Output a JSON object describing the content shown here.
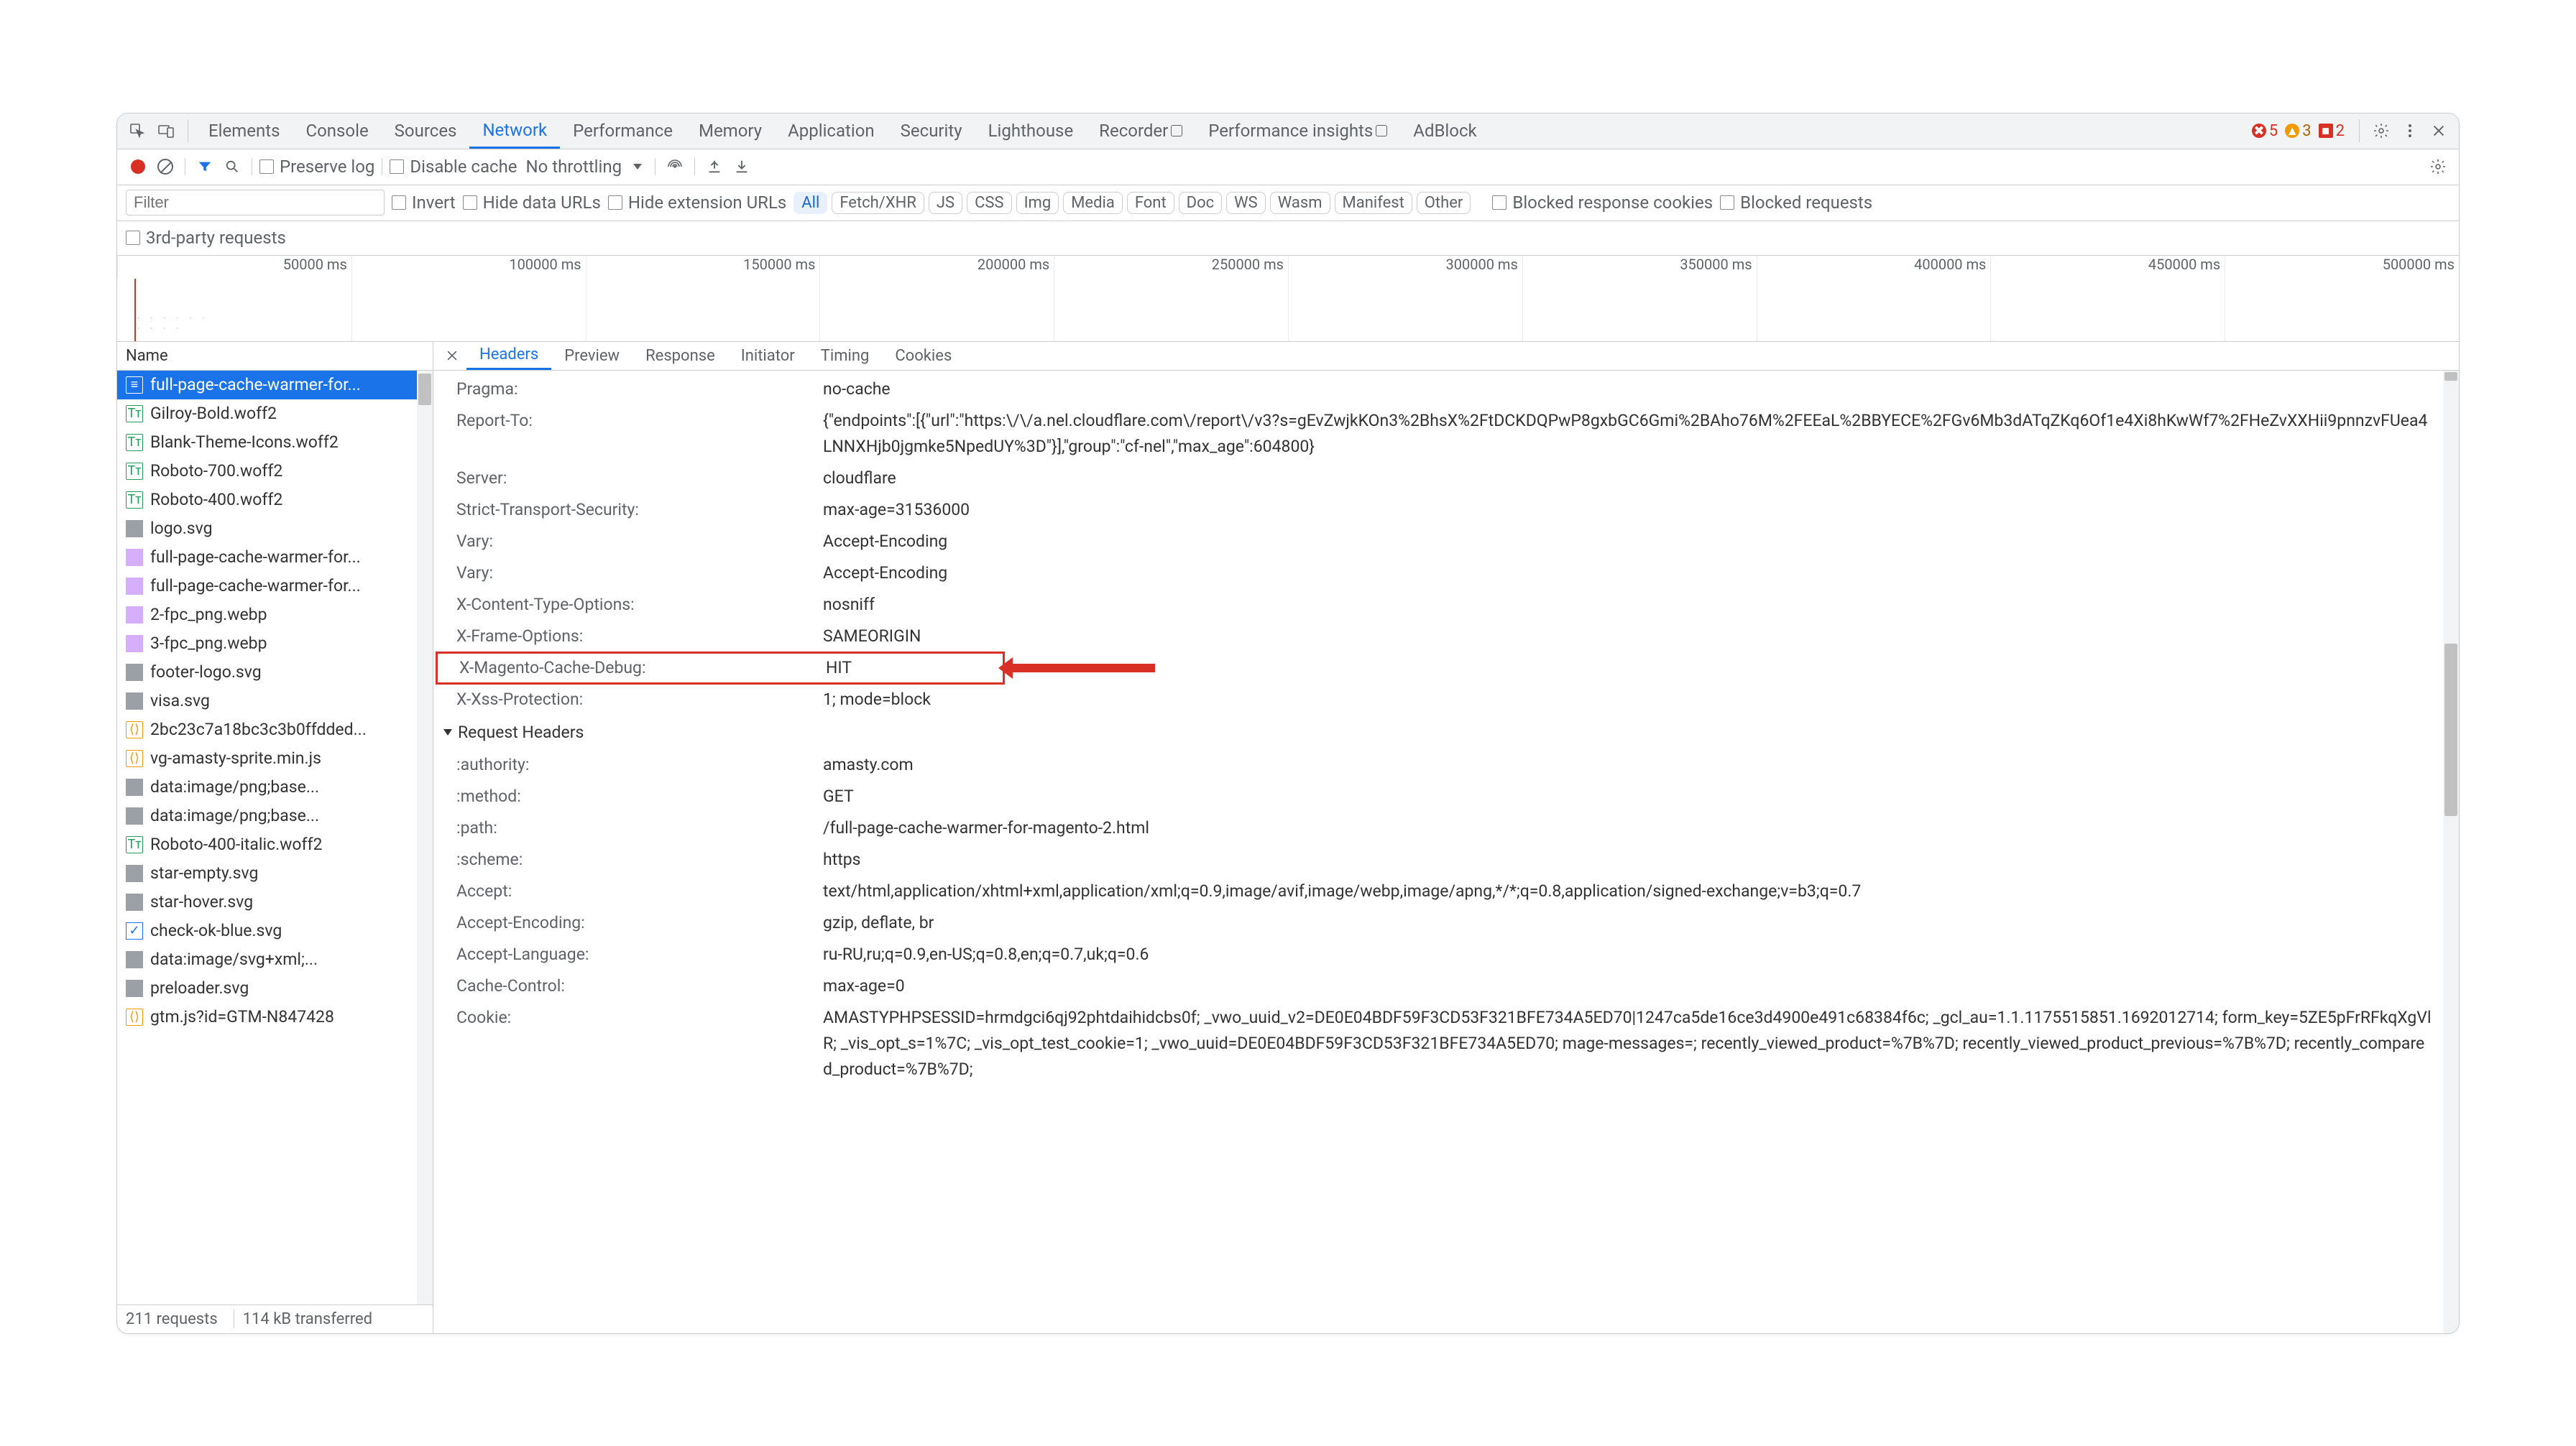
{
  "topTabs": {
    "labels": [
      "Elements",
      "Console",
      "Sources",
      "Network",
      "Performance",
      "Memory",
      "Application",
      "Security",
      "Lighthouse",
      "Recorder",
      "Performance insights",
      "AdBlock"
    ],
    "active": 3
  },
  "badges": {
    "errors": "5",
    "warnings": "3",
    "issues": "2"
  },
  "toolbar": {
    "preserveLog": "Preserve log",
    "disableCache": "Disable cache",
    "throttling": "No throttling"
  },
  "filterRow": {
    "filterPlaceholder": "Filter",
    "invert": "Invert",
    "hideDataUrls": "Hide data URLs",
    "hideExtUrls": "Hide extension URLs",
    "types": [
      "All",
      "Fetch/XHR",
      "JS",
      "CSS",
      "Img",
      "Media",
      "Font",
      "Doc",
      "WS",
      "Wasm",
      "Manifest",
      "Other"
    ],
    "typesActive": 0,
    "blockedCookies": "Blocked response cookies",
    "blockedReq": "Blocked requests"
  },
  "thirdParty": "3rd-party requests",
  "timelineTicks": [
    "50000 ms",
    "100000 ms",
    "150000 ms",
    "200000 ms",
    "250000 ms",
    "300000 ms",
    "350000 ms",
    "400000 ms",
    "450000 ms",
    "500000 ms"
  ],
  "listHeader": "Name",
  "requests": [
    {
      "icon": "doc",
      "name": "full-page-cache-warmer-for..."
    },
    {
      "icon": "font",
      "name": "Gilroy-Bold.woff2"
    },
    {
      "icon": "font",
      "name": "Blank-Theme-Icons.woff2"
    },
    {
      "icon": "font",
      "name": "Roboto-700.woff2"
    },
    {
      "icon": "font",
      "name": "Roboto-400.woff2"
    },
    {
      "icon": "img",
      "name": "logo.svg"
    },
    {
      "icon": "imgc",
      "name": "full-page-cache-warmer-for..."
    },
    {
      "icon": "imgc",
      "name": "full-page-cache-warmer-for..."
    },
    {
      "icon": "imgc",
      "name": "2-fpc_png.webp"
    },
    {
      "icon": "imgc",
      "name": "3-fpc_png.webp"
    },
    {
      "icon": "img",
      "name": "footer-logo.svg"
    },
    {
      "icon": "img",
      "name": "visa.svg"
    },
    {
      "icon": "js",
      "name": "2bc23c7a18bc3c3b0ffdded..."
    },
    {
      "icon": "js",
      "name": "vg-amasty-sprite.min.js"
    },
    {
      "icon": "img",
      "name": "data:image/png;base..."
    },
    {
      "icon": "img",
      "name": "data:image/png;base..."
    },
    {
      "icon": "font",
      "name": "Roboto-400-italic.woff2"
    },
    {
      "icon": "img",
      "name": "star-empty.svg"
    },
    {
      "icon": "img",
      "name": "star-hover.svg"
    },
    {
      "icon": "chk",
      "name": "check-ok-blue.svg"
    },
    {
      "icon": "img",
      "name": "data:image/svg+xml;..."
    },
    {
      "icon": "img",
      "name": "preloader.svg"
    },
    {
      "icon": "js",
      "name": "gtm.js?id=GTM-N847428"
    }
  ],
  "selectedRequest": 0,
  "statusBar": {
    "requests": "211 requests",
    "transferred": "114 kB transferred"
  },
  "detailTabs": {
    "labels": [
      "Headers",
      "Preview",
      "Response",
      "Initiator",
      "Timing",
      "Cookies"
    ],
    "active": 0
  },
  "responseHeaders": [
    {
      "k": "Pragma:",
      "v": "no-cache"
    },
    {
      "k": "Report-To:",
      "v": "{\"endpoints\":[{\"url\":\"https:\\/\\/a.nel.cloudflare.com\\/report\\/v3?s=gEvZwjkKOn3%2BhsX%2FtDCKDQPwP8gxbGC6Gmi%2BAho76M%2FEEaL%2BBYECE%2FGv6Mb3dATqZKq6Of1e4Xi8hKwWf7%2FHeZvXXHii9pnnzvFUea4LNNXHjb0jgmke5NpedUY%3D\"}],\"group\":\"cf-nel\",\"max_age\":604800}"
    },
    {
      "k": "Server:",
      "v": "cloudflare"
    },
    {
      "k": "Strict-Transport-Security:",
      "v": "max-age=31536000"
    },
    {
      "k": "Vary:",
      "v": "Accept-Encoding"
    },
    {
      "k": "Vary:",
      "v": "Accept-Encoding"
    },
    {
      "k": "X-Content-Type-Options:",
      "v": "nosniff"
    },
    {
      "k": "X-Frame-Options:",
      "v": "SAMEORIGIN"
    },
    {
      "k": "X-Magento-Cache-Debug:",
      "v": "HIT",
      "hl": true
    },
    {
      "k": "X-Xss-Protection:",
      "v": "1; mode=block"
    }
  ],
  "requestHeadersTitle": "Request Headers",
  "requestHeaders": [
    {
      "k": ":authority:",
      "v": "amasty.com"
    },
    {
      "k": ":method:",
      "v": "GET"
    },
    {
      "k": ":path:",
      "v": "/full-page-cache-warmer-for-magento-2.html"
    },
    {
      "k": ":scheme:",
      "v": "https"
    },
    {
      "k": "Accept:",
      "v": "text/html,application/xhtml+xml,application/xml;q=0.9,image/avif,image/webp,image/apng,*/*;q=0.8,application/signed-exchange;v=b3;q=0.7"
    },
    {
      "k": "Accept-Encoding:",
      "v": "gzip, deflate, br"
    },
    {
      "k": "Accept-Language:",
      "v": "ru-RU,ru;q=0.9,en-US;q=0.8,en;q=0.7,uk;q=0.6"
    },
    {
      "k": "Cache-Control:",
      "v": "max-age=0"
    },
    {
      "k": "Cookie:",
      "v": "AMASTYPHPSESSID=hrmdgci6qj92phtdaihidcbs0f; _vwo_uuid_v2=DE0E04BDF59F3CD53F321BFE734A5ED70|1247ca5de16ce3d4900e491c68384f6c; _gcl_au=1.1.1175515851.1692012714; form_key=5ZE5pFrRFkqXgVlR; _vis_opt_s=1%7C; _vis_opt_test_cookie=1; _vwo_uuid=DE0E04BDF59F3CD53F321BFE734A5ED70; mage-messages=; recently_viewed_product=%7B%7D; recently_viewed_product_previous=%7B%7D; recently_compared_product=%7B%7D;"
    }
  ]
}
